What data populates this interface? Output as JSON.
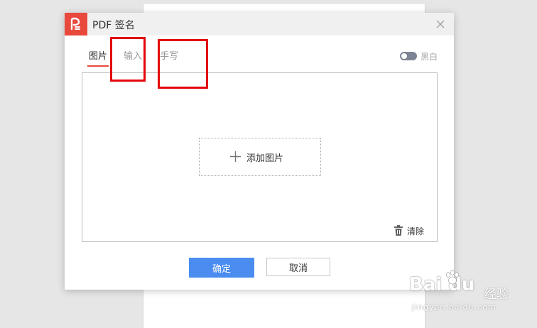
{
  "dialog": {
    "title": "PDF 签名",
    "logo_icon": "pdf-logo-icon",
    "close_icon": "close-icon"
  },
  "tabs": [
    {
      "label": "图片",
      "active": true
    },
    {
      "label": "输入",
      "active": false
    },
    {
      "label": "手写",
      "active": false
    }
  ],
  "toggle": {
    "label": "黑白",
    "on": false
  },
  "canvas": {
    "add_label": "添加图片",
    "add_icon": "plus-icon",
    "clear_label": "清除",
    "clear_icon": "trash-icon"
  },
  "buttons": {
    "confirm": "确定",
    "cancel": "取消"
  },
  "watermark": {
    "logo": "Bai du",
    "text": "经验",
    "url": "jingyan.baidu.com"
  },
  "colors": {
    "accent_red": "#e8493c",
    "confirm_blue": "#4b8cf0",
    "highlight_red": "#e3060b",
    "toggle": "#7d8594"
  }
}
